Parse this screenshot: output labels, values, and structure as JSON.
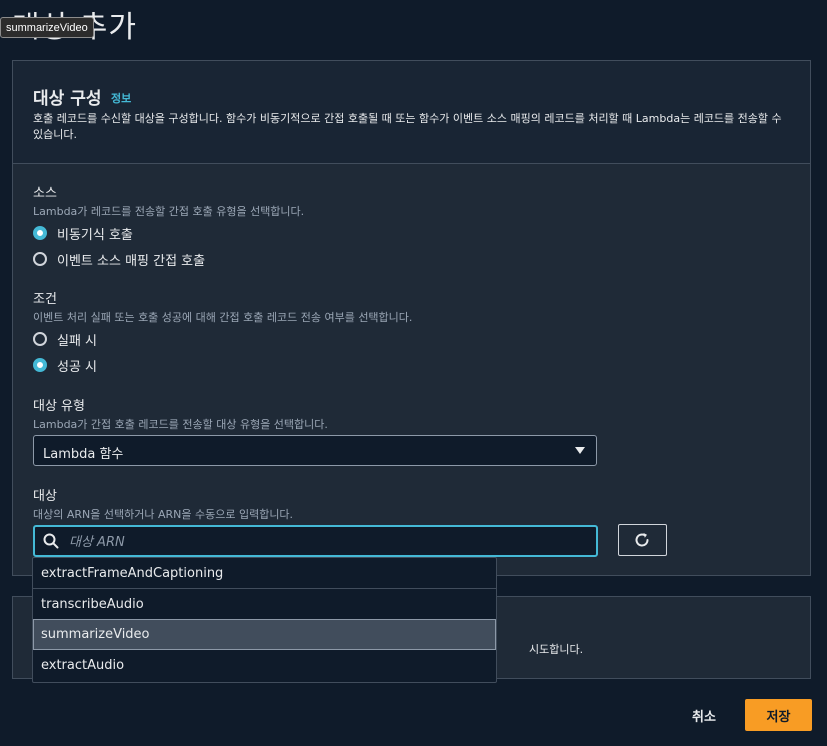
{
  "page": {
    "title": "대상 추가",
    "tooltip": "summarizeVideo"
  },
  "panel": {
    "title": "대상 구성",
    "info_link": "정보",
    "description": "호출 레코드를 수신할 대상을 구성합니다. 함수가 비동기적으로 간접 호출될 때 또는 함수가 이벤트 소스 매핑의 레코드를 처리할 때 Lambda는 레코드를 전송할 수 있습니다."
  },
  "source": {
    "label": "소스",
    "description": "Lambda가 레코드를 전송할 간접 호출 유형을 선택합니다.",
    "options": [
      {
        "label": "비동기식 호출",
        "selected": true
      },
      {
        "label": "이벤트 소스 매핑 간접 호출",
        "selected": false
      }
    ]
  },
  "condition": {
    "label": "조건",
    "description": "이벤트 처리 실패 또는 호출 성공에 대해 간접 호출 레코드 전송 여부를 선택합니다.",
    "options": [
      {
        "label": "실패 시",
        "selected": false
      },
      {
        "label": "성공 시",
        "selected": true
      }
    ]
  },
  "destination_type": {
    "label": "대상 유형",
    "description": "Lambda가 간접 호출 레코드를 전송할 대상 유형을 선택합니다.",
    "selected": "Lambda 함수"
  },
  "destination": {
    "label": "대상",
    "description": "대상의 ARN을 선택하거나 ARN을 수동으로 입력합니다.",
    "placeholder": "대상 ARN",
    "value": "",
    "options": [
      "extractFrameAndCaptioning",
      "transcribeAudio",
      "summarizeVideo",
      "extractAudio"
    ],
    "highlighted": "summarizeVideo"
  },
  "panel2": {
    "partial_text": "시도합니다."
  },
  "footer": {
    "cancel_label": "취소",
    "save_label": "저장"
  },
  "colors": {
    "background": "#0f1b2a",
    "panel": "#1f2a37",
    "accent": "#44b9d6",
    "primary_button": "#f89c24"
  }
}
